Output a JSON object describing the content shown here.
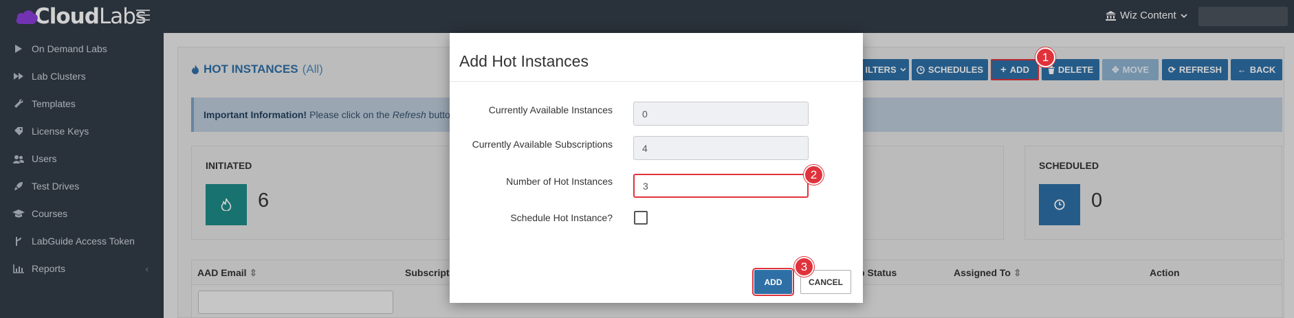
{
  "brand": {
    "name_bold": "Cloud",
    "name_thin": "Labs"
  },
  "header": {
    "org_name": "Wiz Content"
  },
  "sidebar": {
    "items": [
      {
        "label": "On Demand Labs",
        "icon": "play-icon"
      },
      {
        "label": "Lab Clusters",
        "icon": "fast-forward-icon"
      },
      {
        "label": "Templates",
        "icon": "wrench-icon"
      },
      {
        "label": "License Keys",
        "icon": "tag-icon"
      },
      {
        "label": "Users",
        "icon": "users-icon"
      },
      {
        "label": "Test Drives",
        "icon": "rocket-icon"
      },
      {
        "label": "Courses",
        "icon": "graduation-cap-icon"
      },
      {
        "label": "LabGuide Access Token",
        "icon": "branch-icon"
      },
      {
        "label": "Reports",
        "icon": "bar-chart-icon"
      }
    ]
  },
  "page": {
    "title": "HOT INSTANCES",
    "subtitle": "(All)",
    "toolbar": {
      "filters": "ILTERS",
      "schedules": "SCHEDULES",
      "add": "ADD",
      "delete": "DELETE",
      "move": "MOVE",
      "refresh": "REFRESH",
      "back": "BACK"
    },
    "info": {
      "strong": "Important Information!",
      "text_before": "Please click on the",
      "emph": "Refresh",
      "text_after": "button"
    },
    "stats": [
      {
        "label": "INITIATED",
        "value": "6",
        "color": "#1e8c88",
        "icon": "fire-icon"
      },
      {
        "label": "SCHEDULED",
        "value": "0",
        "color": "#2e6fa6",
        "icon": "clock-icon"
      }
    ],
    "table": {
      "columns": [
        "AAD Email",
        "Subscripti",
        "p Status",
        "Assigned To",
        "Action"
      ]
    }
  },
  "modal": {
    "title": "Add Hot Instances",
    "fields": [
      {
        "label": "Currently Available Instances",
        "value": "0"
      },
      {
        "label": "Currently Available Subscriptions",
        "value": "4"
      },
      {
        "label": "Number of Hot Instances",
        "value": "3"
      },
      {
        "label": "Schedule Hot Instance?"
      }
    ],
    "add_label": "ADD",
    "cancel_label": "CANCEL"
  },
  "steps": [
    "1",
    "2",
    "3"
  ],
  "colors": {
    "accent": "#2e6fa6",
    "highlight": "#e0323b",
    "teal": "#1e8c88",
    "sidebar": "#333c47"
  }
}
